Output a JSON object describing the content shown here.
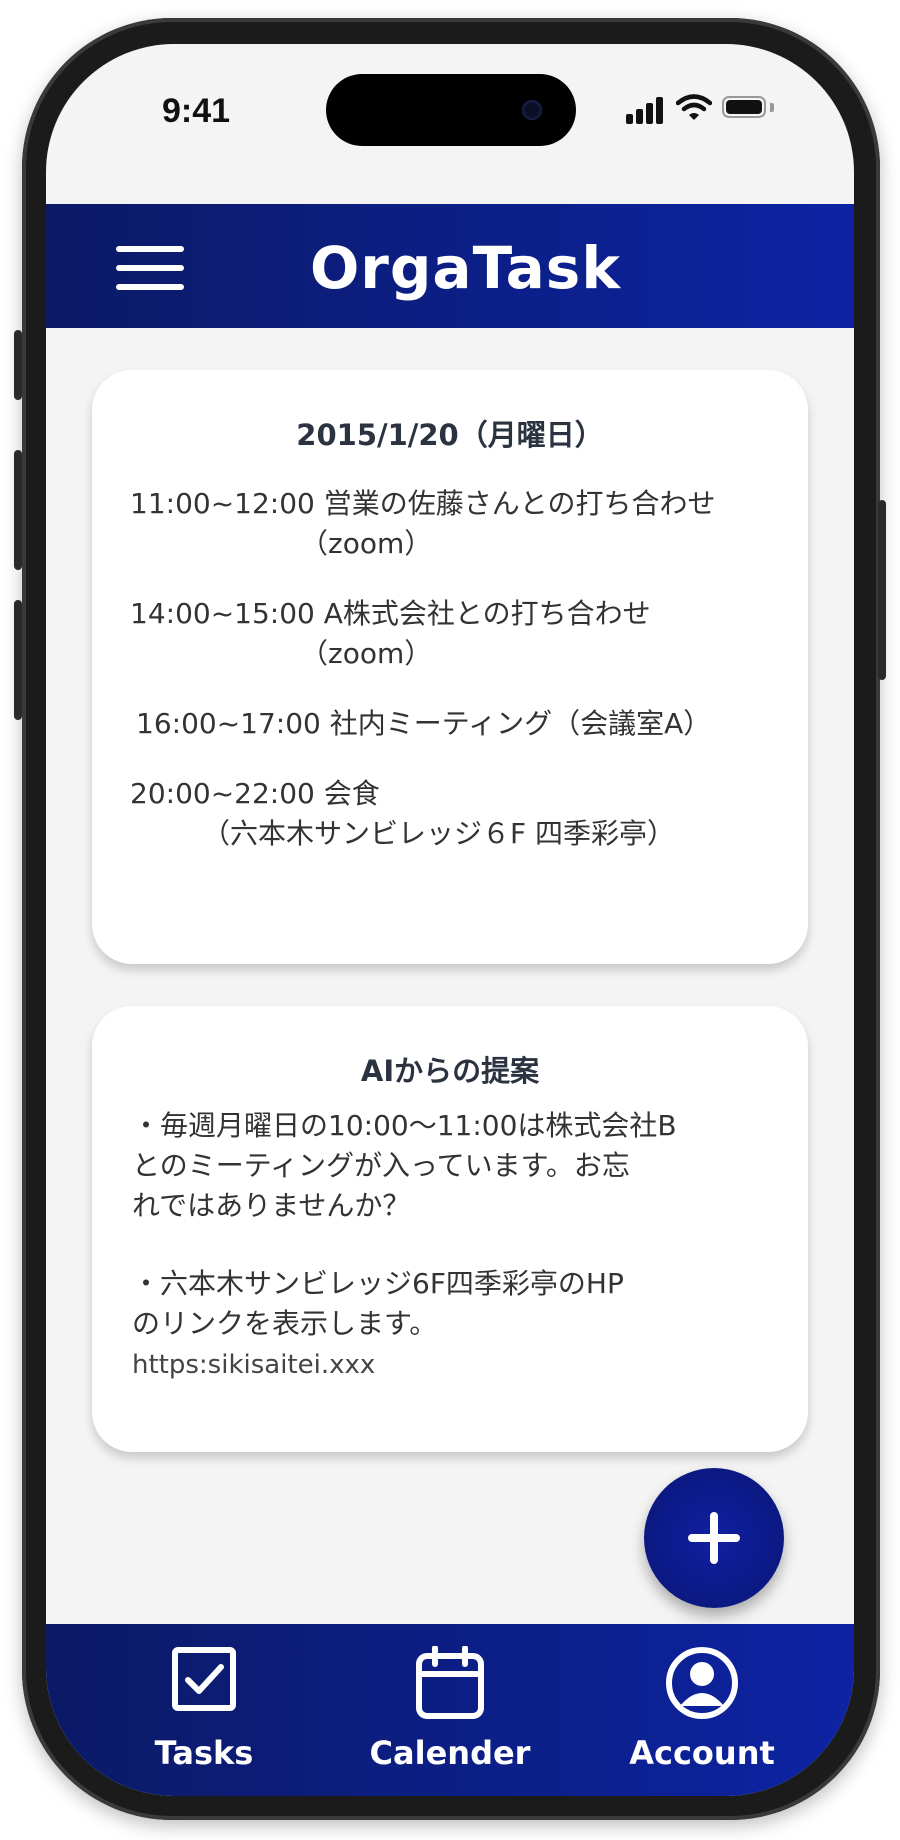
{
  "status_bar": {
    "time": "9:41"
  },
  "header": {
    "app_title": "OrgaTask"
  },
  "schedule": {
    "date_title": "2015/1/20（月曜日）",
    "events": [
      {
        "line1": "11:00~12:00 営業の佐藤さんとの打ち合わせ",
        "line2": "（zoom）"
      },
      {
        "line1": "14:00~15:00 A株式会社との打ち合わせ",
        "line2": "（zoom）"
      },
      {
        "line1": "16:00~17:00 社内ミーティング（会議室A）"
      },
      {
        "line1": "20:00~22:00 会食",
        "line2": "（六本木サンビレッジ６F 四季彩亭）"
      }
    ]
  },
  "ai_suggestions": {
    "title": "AIからの提案",
    "lines": [
      "・毎週月曜日の10:00〜11:00は株式会社B",
      "とのミーティングが入っています。お忘",
      "れではありませんか？",
      "・六本木サンビレッジ6F四季彩亭のHP",
      "のリンクを表示します。"
    ],
    "link": "https:sikisaitei.xxx"
  },
  "fab": {
    "icon": "plus-icon"
  },
  "bottom_nav": {
    "items": [
      {
        "label": "Tasks",
        "icon": "checkbox-icon"
      },
      {
        "label": "Calender",
        "icon": "calendar-icon"
      },
      {
        "label": "Account",
        "icon": "account-icon"
      }
    ]
  },
  "colors": {
    "header_start": "#0b1a66",
    "header_end": "#0d23a3",
    "background": "#f4f4f4",
    "card": "#ffffff"
  }
}
